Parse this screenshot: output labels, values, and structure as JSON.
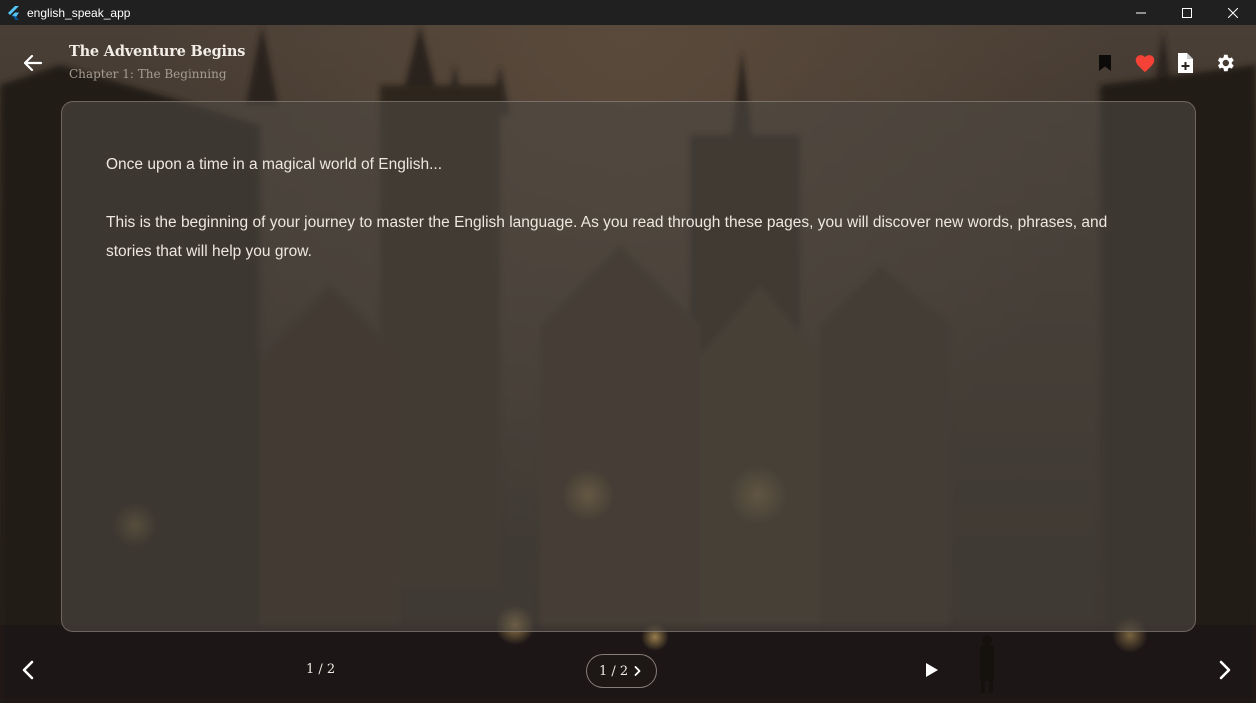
{
  "window": {
    "title": "english_speak_app",
    "controls": {
      "minimize_icon": "minimize-icon",
      "maximize_icon": "maximize-icon",
      "close_icon": "close-icon"
    }
  },
  "appbar": {
    "back_icon": "arrow-left-icon",
    "title": "The Adventure Begins",
    "subtitle": "Chapter 1: The Beginning",
    "actions": [
      "bookmark-icon",
      "heart-icon",
      "note-add-icon",
      "gear-icon"
    ]
  },
  "content": {
    "paragraphs": [
      "Once upon a time in a magical world of English...",
      "This is the beginning of your journey to master the English language. As you read through these pages, you will discover new words, phrases, and stories that will help you grow."
    ]
  },
  "footer": {
    "page_indicator": "1 / 2",
    "page_selector": "1 / 2",
    "prev_icon": "chevron-left-icon",
    "next_icon": "chevron-right-icon",
    "play_icon": "play-icon"
  },
  "colors": {
    "heart": "#f44336",
    "titlebar": "#202020",
    "panel": "#4e4842"
  }
}
